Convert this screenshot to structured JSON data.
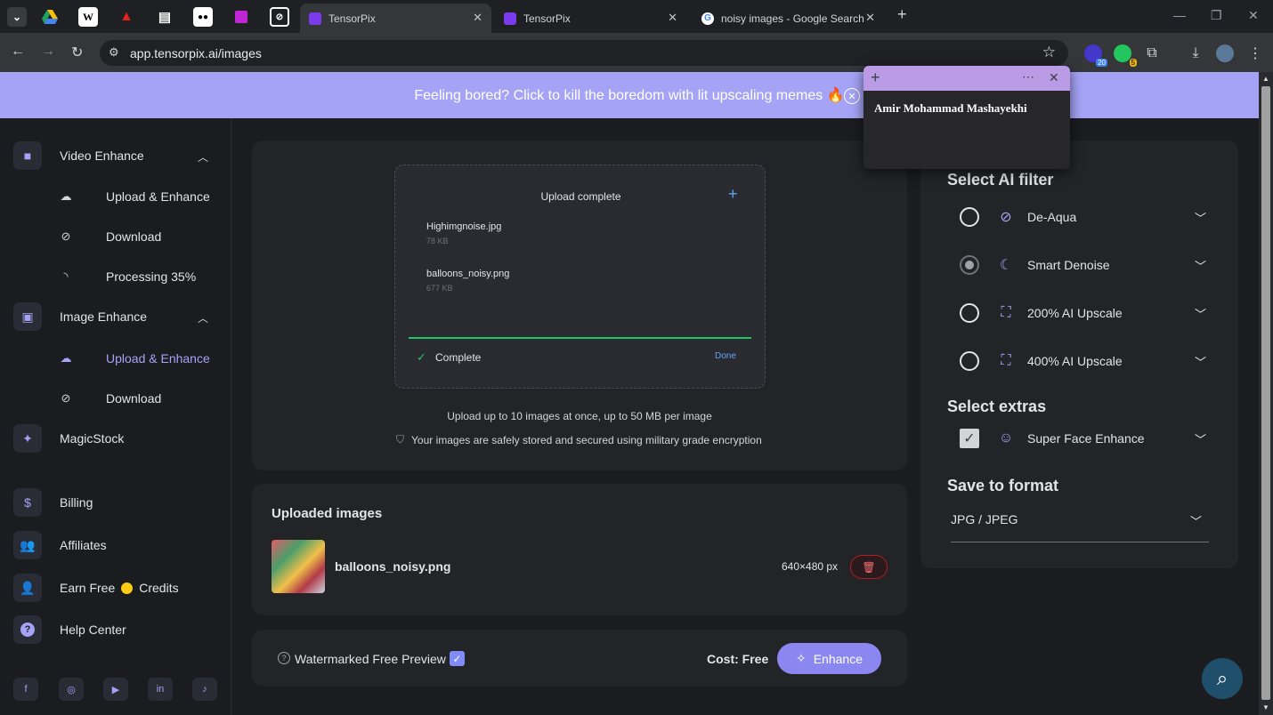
{
  "browser": {
    "tabs": [
      {
        "title": "TensorPix",
        "active": true
      },
      {
        "title": "TensorPix",
        "active": false
      },
      {
        "title": "noisy images - Google Search",
        "active": false
      }
    ],
    "pinned_icons": [
      "chevron-down-icon",
      "google-drive-icon",
      "wikipedia-icon",
      "adobe-icon",
      "notion-icon",
      "medium-icon",
      "tensorpix-icon",
      "perplexity-icon"
    ],
    "url": "app.tensorpix.ai/images",
    "extension_badges": {
      "ext1": "20",
      "ext2": "5"
    }
  },
  "banner": {
    "text": "Feeling bored? Click to kill the boredom with lit upscaling memes 🔥",
    "accent": "#a5a3f5"
  },
  "sidebar": {
    "video": {
      "label": "Video Enhance",
      "upload": "Upload & Enhance",
      "download": "Download",
      "processing": "Processing 35%"
    },
    "image": {
      "label": "Image Enhance",
      "upload": "Upload & Enhance",
      "download": "Download"
    },
    "magicstock": "MagicStock",
    "billing": "Billing",
    "affiliates": "Affiliates",
    "earn_prefix": "Earn Free",
    "earn_suffix": "Credits",
    "help": "Help Center",
    "socials": [
      "facebook-icon",
      "instagram-icon",
      "youtube-icon",
      "linkedin-icon",
      "tiktok-icon"
    ]
  },
  "upload": {
    "title": "Upload complete",
    "files": [
      {
        "name": "Highimgnoise.jpg",
        "size": "78 KB"
      },
      {
        "name": "balloons_noisy.png",
        "size": "677 KB"
      }
    ],
    "status": "Complete",
    "done": "Done",
    "progress": 1.0,
    "limit_text": "Upload up to 10 images at once, up to 50 MB per image",
    "security_text": "Your images are safely stored and secured using military grade encryption"
  },
  "uploaded": {
    "title": "Uploaded images",
    "file_name": "balloons_noisy.png",
    "dimensions": "640×480 px"
  },
  "footer": {
    "watermark_label": "Watermarked Free Preview",
    "watermark_checked": true,
    "cost": "Cost: Free",
    "enhance": "Enhance"
  },
  "settings": {
    "filter_title": "Select AI filter",
    "filters": [
      {
        "label": "De-Aqua",
        "selected": false
      },
      {
        "label": "Smart Denoise",
        "selected": true
      },
      {
        "label": "200% AI Upscale",
        "selected": false
      },
      {
        "label": "400% AI Upscale",
        "selected": false
      }
    ],
    "extras_title": "Select extras",
    "extras": [
      {
        "label": "Super Face Enhance",
        "checked": true
      }
    ],
    "format_title": "Save to format",
    "format_value": "JPG / JPEG"
  },
  "note": {
    "author": "Amir Mohammad Mashayekhi"
  }
}
